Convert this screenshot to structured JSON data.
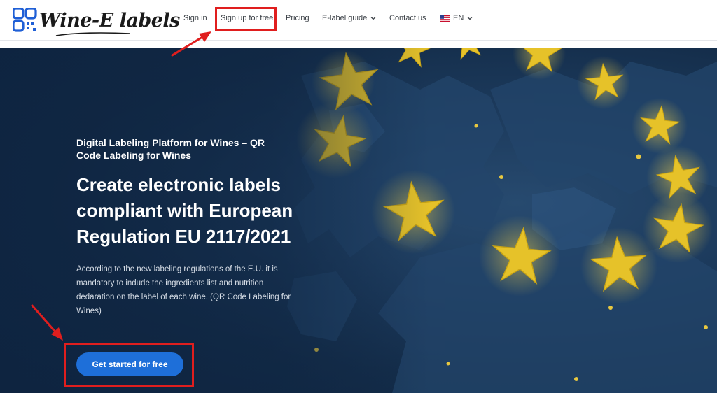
{
  "header": {
    "logo_text": "Wine-E labels",
    "nav": {
      "sign_in": "Sign in",
      "sign_up": "Sign up for free",
      "pricing": "Pricing",
      "elabel_guide": "E-label guide",
      "contact": "Contact us",
      "language": "EN"
    }
  },
  "hero": {
    "eyebrow": "Digital Labeling Platform for Wines – QR Code Labeling for Wines",
    "headline": "Create electronic labels compliant with European Regulation EU 2117/2021",
    "description": "According to the new labeling regulations of the E.U. it is mandatory to indude the ingredients list and nutrition dedaration on the label of each wine. (QR Code Labeling for Wines)",
    "cta_label": "Get started for free"
  },
  "colors": {
    "accent": "#1e6fd9",
    "annotation": "#e01e1e",
    "star": "#e6c229",
    "hero_bg": "#1c3a5c"
  },
  "icons": [
    "qr-logo-icon",
    "chevron-down-icon",
    "us-flag-icon",
    "annotation-arrow-icon"
  ]
}
